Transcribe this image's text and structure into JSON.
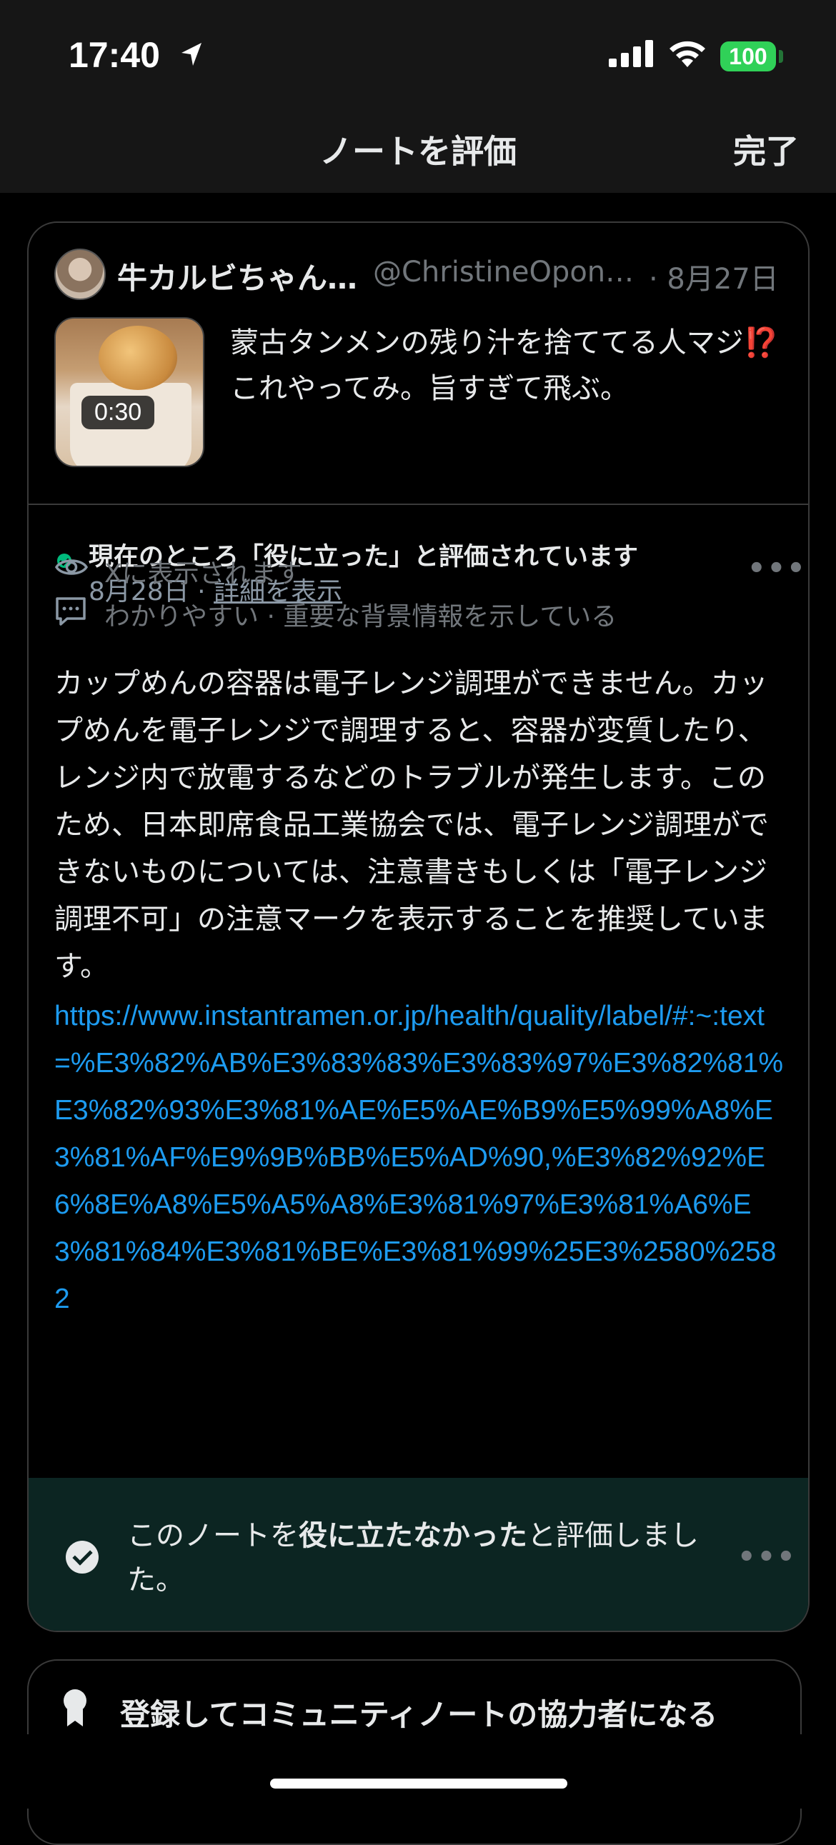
{
  "status_bar": {
    "time": "17:40",
    "battery": "100"
  },
  "nav": {
    "title": "ノートを評価",
    "done": "完了"
  },
  "tweet": {
    "author_name": "牛カルビちゃん…",
    "handle": "@ChristineOpon…",
    "date": "· 8月27日",
    "video_duration": "0:30",
    "text_before_emoji": "蒙古タンメンの残り汁を捨ててる人マジ",
    "emoji": "⁉️",
    "text_after_emoji": "これやってみ。旨すぎて飛ぶ。"
  },
  "note": {
    "status": "現在のところ「役に立った」と評価されています",
    "date": "8月28日",
    "separator": " · ",
    "details_link": "詳細を表示",
    "shown_on_x": "Xに表示されます",
    "reasons": "わかりやすい · 重要な背景情報を示している",
    "body": "カップめんの容器は電子レンジ調理ができません。カップめんを電子レンジで調理すると、容器が変質したり、レンジ内で放電するなどのトラブルが発生します。このため、日本即席食品工業協会では、電子レンジ調理ができないものについては、注意書きもしくは「電子レンジ調理不可」の注意マークを表示することを推奨しています。",
    "link": "https://www.instantramen.or.jp/health/quality/label/#:~:text=%E3%82%AB%E3%83%83%E3%83%97%E3%82%81%E3%82%93%E3%81%AE%E5%AE%B9%E5%99%A8%E3%81%AF%E9%9B%BB%E5%AD%90,%E3%82%92%E6%8E%A8%E5%A5%A8%E3%81%97%E3%81%A6%E3%81%84%E3%81%BE%E3%81%99%25E3%2580%2582"
  },
  "rating": {
    "prefix": "このノートを",
    "emphasis": "役に立たなかった",
    "suffix": "と評価しました。"
  },
  "contributor": {
    "label": "登録してコミュニティノートの協力者になる"
  },
  "colors": {
    "link": "#1d9bf0",
    "status_green": "#00ba7c",
    "rating_bg": "#0c2522",
    "battery": "#30d158"
  },
  "icons": {
    "location": "location-arrow-icon",
    "eye": "eye-icon",
    "comment": "comment-icon",
    "check": "check-circle-icon",
    "medal": "medal-icon"
  }
}
